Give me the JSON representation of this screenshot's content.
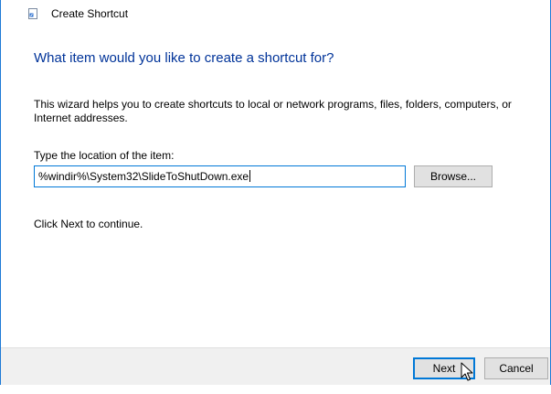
{
  "window": {
    "title": "Create Shortcut",
    "title_icon": "shortcut-wizard-icon",
    "accent_color": "#0078d7"
  },
  "main": {
    "heading": "What item would you like to create a shortcut for?",
    "heading_color": "#003399",
    "description": "This wizard helps you to create shortcuts to local or network programs, files, folders, computers, or Internet addresses.",
    "location_label": "Type the location of the item:",
    "location_value": "%windir%\\System32\\SlideToShutDown.exe",
    "browse_label": "Browse...",
    "continue_text": "Click Next to continue."
  },
  "footer": {
    "next_label": "Next",
    "cancel_label": "Cancel"
  }
}
